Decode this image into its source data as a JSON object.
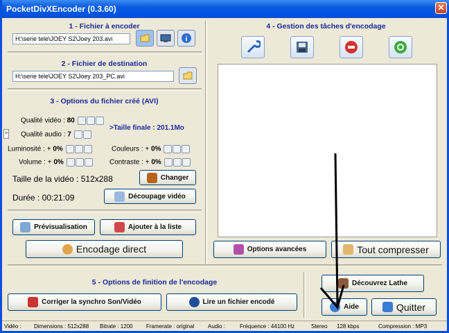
{
  "window": {
    "title": "PocketDivXEncoder (0.3.60)",
    "close_glyph": "✕"
  },
  "section1": {
    "title": "1 - Fichier à encoder",
    "source_path": "H:\\serie tele\\JOEY S2\\Joey 203.avi",
    "icons": [
      "open-folder-icon",
      "preview-screen-icon",
      "info-icon"
    ]
  },
  "section2": {
    "title": "2 - Fichier de destination",
    "dest_path": "H:\\serie tele\\JOEY S2\\Joey 203_PC.avi"
  },
  "section3": {
    "title": "3 - Options du fichier créé (AVI)",
    "video_quality_label": "Qualité vidéo :",
    "video_quality_value": "80",
    "audio_quality_label": "Qualité audio :",
    "audio_quality_value": "7",
    "final_size": ">Taille finale : 201.1Mo",
    "brightness_label": "Luminosité : +",
    "brightness_value": "0%",
    "colors_label": "Couleurs : +",
    "colors_value": "0%",
    "volume_label": "Volume : +",
    "volume_value": "0%",
    "contrast_label": "Contraste : +",
    "contrast_value": "0%",
    "video_size": "Taille de la vidéo : 512x288",
    "change_button": "Changer",
    "duration": "Durée : 00:21:09",
    "cut_button": "Découpage vidéo",
    "preview_button": "Prévisualisation",
    "add_list_button": "Ajouter à la liste",
    "direct_encode_button": "Encodage direct",
    "side_tab": ">"
  },
  "section4": {
    "title": "4 - Gestion des tâches d'encodage",
    "advanced_button": "Options avancées",
    "compress_all_button": "Tout compresser"
  },
  "section5": {
    "title": "5 - Options de finition de l'encodage",
    "sync_button": "Corriger la synchro Son/Vidéo",
    "play_button": "Lire un fichier encodé",
    "lathe_button": "Découvrez Lathe",
    "help_button": "Aide",
    "quit_button": "Quitter"
  },
  "statusbar": {
    "video": "Vidéo :",
    "dimensions": "Dimensions : 512x288",
    "bitrate": "Bitrate : 1200",
    "framerate": "Framerate : original",
    "audio": "Audio :",
    "frequency": "Fréquence : 44100 Hz",
    "stereo": "Stereo",
    "kbps": "128 kbps",
    "compression": "Compression : MP3"
  },
  "colors": {
    "title_blue": "#1d2a9b",
    "final_size_blue": "#1d2a9b",
    "titlebar": "#0054e3"
  }
}
